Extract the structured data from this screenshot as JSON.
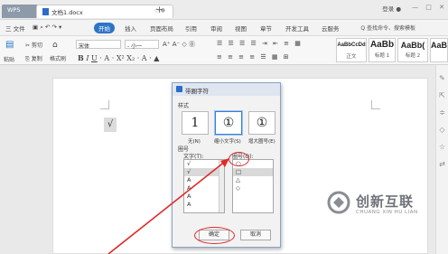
{
  "tabs": {
    "app": "WPS",
    "document": "文档1.docx",
    "add": "+"
  },
  "window": {
    "login": "登录",
    "minimize": "—",
    "maximize": "□",
    "close": "✕"
  },
  "menu": {
    "file": "三 文件",
    "items": [
      "开始",
      "插入",
      "页面布局",
      "引用",
      "审阅",
      "视图",
      "章节",
      "开发工具",
      "云服务"
    ],
    "active_index": 0,
    "search": "Q 查找命令、搜索模板"
  },
  "ribbon": {
    "cut": "剪切",
    "paste": "粘贴",
    "copy": "复制",
    "format_painter": "格式刷",
    "font_name": "宋体",
    "font_size": "- 小一",
    "styles": [
      {
        "sample": "AaBbCcDd",
        "name": "正文"
      },
      {
        "sample": "AaBb",
        "name": "标题 1"
      },
      {
        "sample": "AaBb(",
        "name": "标题 2"
      },
      {
        "sample": "AaBl",
        "name": ""
      }
    ]
  },
  "document": {
    "checkmark": "√"
  },
  "dialog": {
    "title": "带圈字符",
    "style_section": "样式",
    "styles": [
      {
        "glyph": "1",
        "caption": "无(N)"
      },
      {
        "glyph": "①",
        "caption": "缩小文字(S)"
      },
      {
        "glyph": "①",
        "caption": "增大圈号(E)"
      }
    ],
    "selected_style": 1,
    "circle_section": "圈号",
    "text_label": "文字(T):",
    "text_items": [
      "√",
      "√",
      "A",
      "A",
      "A",
      "A"
    ],
    "circle_label": "圈号(O):",
    "circle_items": [
      "○",
      "□",
      "△",
      "◇"
    ],
    "selected_circle": 1,
    "ok": "确定",
    "cancel": "取消"
  },
  "watermark": {
    "cn": "创新互联",
    "en": "CHUANG XIN HU LIAN"
  },
  "colors": {
    "accent": "#2c74c6",
    "annotation_red": "#e02a2a"
  }
}
